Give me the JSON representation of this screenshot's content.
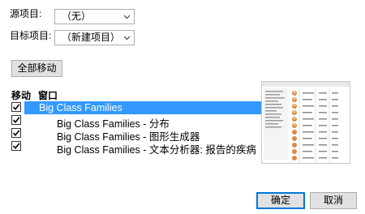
{
  "source": {
    "label": "源项目:",
    "value": "（无）"
  },
  "target": {
    "label": "目标项目:",
    "value": "（新建项目）"
  },
  "move_all_button": "全部移动",
  "headers": {
    "move": "移动",
    "window": "窗口"
  },
  "windows": [
    {
      "name": "Big Class Families",
      "checked": true,
      "selected": true,
      "indent": 0
    },
    {
      "name": "Big Class Families - 分布",
      "checked": true,
      "selected": false,
      "indent": 1
    },
    {
      "name": "Big Class Families - 图形生成器",
      "checked": true,
      "selected": false,
      "indent": 1
    },
    {
      "name": "Big Class Families - 文本分析器: 报告的疾病",
      "checked": true,
      "selected": false,
      "indent": 1
    }
  ],
  "buttons": {
    "ok": "确定",
    "cancel": "取消"
  },
  "colors": {
    "selection": "#3399ff",
    "accent": "#0078d7"
  }
}
